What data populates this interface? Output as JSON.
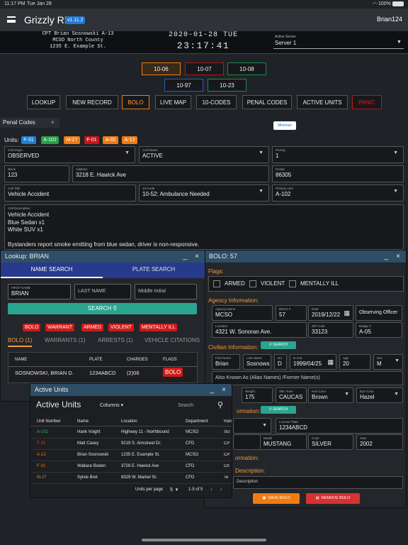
{
  "status_bar": {
    "time": "11:17 PM",
    "date": "Tue Jan 28",
    "battery": "100%"
  },
  "app": {
    "title": "Grizzly RP",
    "version": "v1.11.2",
    "username": "Brian124"
  },
  "header": {
    "officer_line1": "CPT Brian Sosnowski A-13",
    "officer_line2": "MCSO North County",
    "officer_line3": "1235 E. Example St.",
    "date": "2020-01-28 TUE",
    "time": "23:17:41",
    "server_label": "Active Server",
    "server_value": "Server 1"
  },
  "status_codes": [
    "10-06",
    "10-07",
    "10-08",
    "10-97",
    "10-23"
  ],
  "nav": [
    "LOOKUP",
    "NEW RECORD",
    "BOLO",
    "LIVE MAP",
    "10-CODES",
    "PENAL CODES",
    "ACTIVE UNITS",
    "PANIC"
  ],
  "penal_tab": {
    "label": "Penal Codes",
    "close": "×"
  },
  "minimize_label": "Minimize",
  "units": {
    "label": "Units:",
    "items": [
      {
        "code": "F-31",
        "color": "#1e7ed8"
      },
      {
        "code": "A-102",
        "color": "#25a14a"
      },
      {
        "code": "M-27",
        "color": "#f07b12"
      },
      {
        "code": "F-01",
        "color": "#c8141c"
      },
      {
        "code": "A-02",
        "color": "#f07b12"
      },
      {
        "code": "A-13",
        "color": "#f07b12"
      }
    ]
  },
  "call": {
    "origin_label": "Call Origin",
    "origin": "OBSERVED",
    "status_label": "Call Status",
    "status": "ACTIVE",
    "priority_label": "Priority",
    "priority": "1",
    "block_label": "Block",
    "block": "123",
    "address_label": "Address",
    "address": "3218 E. Hawick Ave",
    "postal_label": "Postal",
    "postal": "86305",
    "title_label": "Call Title",
    "title": "Vehicle Accident",
    "code_label": "10-Code",
    "code": "10-52: Ambulance Needed",
    "primary_label": "Primary Unit",
    "primary": "A-102",
    "desc_label": "Call Description",
    "desc_lines": [
      "Vehicle Accident",
      "Blue Sedan x1",
      "White SUV x1",
      "",
      "Bystanders report smoke emitting from blue sedan, driver is non-responsive."
    ]
  },
  "lookup": {
    "title": "Lookup: BRIAN",
    "min": "_",
    "close": "×",
    "tab_name": "NAME SEARCH",
    "tab_plate": "PLATE SEARCH",
    "first_label": "FIRST NAME",
    "first": "BRIAN",
    "last_placeholder": "LAST NAME",
    "middle_placeholder": "Middle Initial",
    "search": "SEARCH",
    "flags": [
      "BOLO",
      "WARRANT",
      "ARMED",
      "VIOLENT",
      "MENTALLY ILL"
    ],
    "result_tabs": [
      "BOLO (1)",
      "WARRANTS (1)",
      "ARRESTS (1)",
      "VEHICLE CITATIONS (2"
    ],
    "cols": [
      "NAME",
      "PLATE",
      "CHARGES",
      "FLAGS"
    ],
    "row": {
      "name": "SOSNOWSKI, BRIAN D.",
      "plate": "1234ABCD",
      "charges": "(2)06",
      "flag": "BOLO"
    }
  },
  "bolo": {
    "title": "BOLO: 57",
    "min": "_",
    "close": "×",
    "flags_header": "Flags:",
    "flags": [
      "ARMED",
      "VIOLENT",
      "MENTALLY ILL"
    ],
    "agency_header": "Agency Information:",
    "agency_name_label": "Agency Name",
    "agency_name": "MCSO",
    "bolo_num_label": "BOLO #",
    "bolo_num": "57",
    "date_label": "Date",
    "date": "2019/12/22",
    "observing": "Observing Officer",
    "location_label": "Location",
    "location": "4321 W. Sonoran Ave.",
    "zip_label": "ZIP Code",
    "zip": "33123",
    "badge_label": "Badge #",
    "badge": "A-05",
    "civilian_header": "Civilian Information:",
    "search": "SEARCH",
    "first_label": "First Name",
    "first": "Brian",
    "last_label": "Last Name",
    "last": "Sosnows",
    "mi_label": "M.I.",
    "mi": "D",
    "dob_label": "D.O.B.",
    "dob": "1999/04/25",
    "age_label": "Age",
    "age": "20",
    "sex_label": "Sex",
    "sex": "M",
    "aka": "Also Known As (Alias Names) /Former Name(s)",
    "weight_label": "Weight",
    "weight": "175",
    "skin_label": "Skin Tone",
    "skin": "CAUCAS",
    "hair_label": "Hair Color",
    "hair": "Brown",
    "eye_label": "Eye Color",
    "eye": "Hazel",
    "vehicle_header_tail": "ormation:",
    "plate_label": "License Plate",
    "plate": "1234ABCD",
    "model_label": "Model",
    "model": "MUSTANG",
    "color_label": "Color",
    "color": "SILVER",
    "year_label": "Year",
    "year": "2002",
    "info_tail": "ormation:",
    "desc_tail": "Description:",
    "desc_field": "Description",
    "save": "SAVE BOLO",
    "remove": "REMOVE BOLO"
  },
  "active_units": {
    "title": "Active Units",
    "min": "_",
    "close": "×",
    "heading": "Active Units",
    "columns_btn": "Columns",
    "search_placeholder": "Search",
    "cols": [
      "Unit Number",
      "Name",
      "Location",
      "Department",
      "Ran"
    ],
    "rows": [
      {
        "unit": "A-102",
        "name": "Hank Voight",
        "loc": "Highway 11 - Northbound",
        "dept": "MCSO",
        "rank": "SG",
        "color": "#2fb36a"
      },
      {
        "unit": "F-31",
        "name": "Matt Casey",
        "loc": "9219 S. Aimstreet Dr.",
        "dept": "CFD",
        "rank": "CP",
        "color": "#2f8de0"
      },
      {
        "unit": "A-13",
        "name": "Brian Sosnowski",
        "loc": "1235 E. Example St.",
        "dept": "MCSO",
        "rank": "CP",
        "color": "#f07b12"
      },
      {
        "unit": "F-01",
        "name": "Wallace Boden",
        "loc": "3728 E. Hawick Ave",
        "dept": "CFD",
        "rank": "Ch",
        "color": "#e0402a"
      },
      {
        "unit": "M-27",
        "name": "Sylvie Bret",
        "loc": "8329 W. Markel St.",
        "dept": "CFD",
        "rank": "Te",
        "color": "#f07b12"
      }
    ],
    "per_page_label": "Units per page",
    "per_page": "5",
    "range": "1-5 of 5"
  }
}
